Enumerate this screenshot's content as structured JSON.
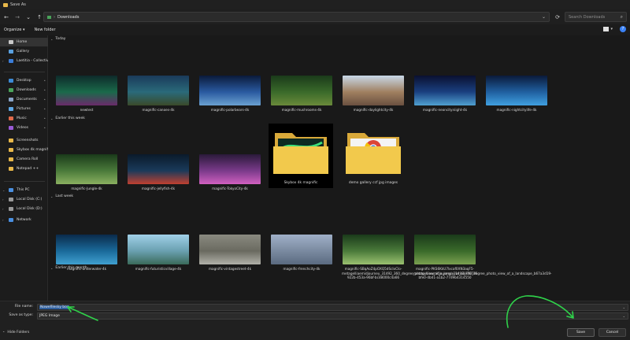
{
  "window": {
    "title": "Save As"
  },
  "nav": {
    "back_icon": "←",
    "forward_icon": "→",
    "recent_icon": "⌄",
    "up_icon": "↑",
    "breadcrumb_sep": "›",
    "address": "Downloads",
    "address_chevron": "⌄",
    "refresh_icon": "⟳",
    "search_placeholder": "Search Downloads",
    "search_icon": "⌕"
  },
  "toolbar": {
    "organize": "Organize ▾",
    "new_folder": "New folder",
    "view_chevron": "▾",
    "help": "?"
  },
  "sidebar": {
    "items": [
      {
        "label": "Home",
        "color": "#c9c9c9",
        "pinned": false,
        "expand": ""
      },
      {
        "label": "Gallery",
        "color": "#5aa0e0",
        "pinned": false,
        "expand": ""
      },
      {
        "label": "Laetitia - Collectivi",
        "color": "#3b7dd8",
        "pinned": false,
        "expand": "›"
      },
      {
        "label": "Desktop",
        "color": "#3c8ad6",
        "pinned": true,
        "expand": ""
      },
      {
        "label": "Downloads",
        "color": "#4aa35a",
        "pinned": true,
        "expand": ""
      },
      {
        "label": "Documents",
        "color": "#8aa4c8",
        "pinned": true,
        "expand": ""
      },
      {
        "label": "Pictures",
        "color": "#5fa8e6",
        "pinned": true,
        "expand": ""
      },
      {
        "label": "Music",
        "color": "#e06a4a",
        "pinned": true,
        "expand": ""
      },
      {
        "label": "Videos",
        "color": "#9a5ad6",
        "pinned": true,
        "expand": ""
      },
      {
        "label": "Screenshots",
        "color": "#e8b84a",
        "pinned": false,
        "expand": ""
      },
      {
        "label": "Skybox 4k magnific",
        "color": "#e8b84a",
        "pinned": false,
        "expand": ""
      },
      {
        "label": "Camera Roll",
        "color": "#e8b84a",
        "pinned": false,
        "expand": ""
      },
      {
        "label": "Notepad ++",
        "color": "#e8b84a",
        "pinned": false,
        "expand": ""
      },
      {
        "label": "This PC",
        "color": "#4a8fe0",
        "pinned": false,
        "expand": "⌄"
      },
      {
        "label": "Local Disk (C:)",
        "color": "#9a9a9a",
        "pinned": false,
        "expand": "›"
      },
      {
        "label": "Local Disk (D:)",
        "color": "#9a9a9a",
        "pinned": false,
        "expand": "›"
      },
      {
        "label": "Network",
        "color": "#4a8fe0",
        "pinned": false,
        "expand": "›"
      }
    ],
    "pin_glyph": "📌"
  },
  "groups": [
    {
      "label": "Today",
      "chevron": "⌄"
    },
    {
      "label": "Earlier this week",
      "chevron": "⌄"
    },
    {
      "label": "Last week",
      "chevron": "⌄"
    },
    {
      "label": "Earlier this month",
      "chevron": "⌄"
    }
  ],
  "files": [
    {
      "label": "newtest",
      "colors": [
        "#0e2a2a",
        "#1a6a4a",
        "#6a2a6a"
      ]
    },
    {
      "label": "magnific-canoes-4k",
      "colors": [
        "#1a3a5a",
        "#2a6a7a",
        "#3a4a2a"
      ]
    },
    {
      "label": "magnific-polarbears-4k",
      "colors": [
        "#0a1a3a",
        "#2a5aa0",
        "#6aa0d0"
      ]
    },
    {
      "label": "magnific-mushrooms-4k",
      "colors": [
        "#1a3a1a",
        "#3a6a2a",
        "#6a8a3a"
      ]
    },
    {
      "label": "magnific-daylightcity-4k",
      "colors": [
        "#c8d8e8",
        "#a08060",
        "#6a5040"
      ]
    },
    {
      "label": "magnific-neoncityniight-4k",
      "colors": [
        "#0a1030",
        "#1a4080",
        "#50a0d0"
      ]
    },
    {
      "label": "magnific-nightcitylife-4k",
      "colors": [
        "#0a1a3a",
        "#2060a0",
        "#40a0e0"
      ]
    },
    {
      "label": "magnific-Jungle-4k",
      "colors": [
        "#1a3a1a",
        "#4a7a3a",
        "#8ab060"
      ]
    },
    {
      "label": "magnific-jellyfish-4k",
      "colors": [
        "#0a1a2a",
        "#1a3a5a",
        "#c04030"
      ]
    },
    {
      "label": "magnific-TokyoCity-4k",
      "colors": [
        "#2a1a3a",
        "#7a3a8a",
        "#d060c0"
      ]
    },
    {
      "label": "magnific-underwater-4k",
      "colors": [
        "#0a2a4a",
        "#1a6a9a",
        "#40a0d0"
      ]
    },
    {
      "label": "magnific-futuristicvillage-4k",
      "colors": [
        "#a0d0e8",
        "#6aa0b0",
        "#3a6a5a"
      ]
    },
    {
      "label": "magnific-vintagestreet-4k",
      "colors": [
        "#8a8a80",
        "#6a6a60",
        "#b0b0a8"
      ]
    },
    {
      "label": "magnific-frenchcity-4k",
      "colors": [
        "#a0b0c8",
        "#7a8aa0",
        "#5a6a80"
      ]
    },
    {
      "label": "magnific-SBqAoZ4pOXQ5dScIxClo-metagelliaemidjourney_31492_360_degree_photo_view_of_a_jungle_wi_a8e76736-922b-453a-96bf-bcd8000c4a66",
      "colors": [
        "#1a3a1a",
        "#4a7a3a",
        "#9ac070"
      ]
    },
    {
      "label": "magnific-PKS6KkU7lxcaf0XN3aqF5-metagelliaemidjourney_31492_360_degree_photo_view_of_a_landscape_b67a3d19-bfe0-4b41-a1b2-77d9b4314550",
      "colors": [
        "#1a3a1a",
        "#3a6a2a",
        "#7aa050"
      ]
    }
  ],
  "folders": [
    {
      "label": "Skybox 4k magnific",
      "emblem": "aurora"
    },
    {
      "label": "demo gallery ccf jpg images",
      "emblem": "chrome"
    }
  ],
  "save": {
    "file_name_label": "File name:",
    "file_name_value": "Nowefilesky box",
    "save_type_label": "Save as type:",
    "save_type_value": "JPEG Image",
    "dropdown_chevron": "⌄",
    "hide_folders_chevron": "⌃",
    "hide_folders": "Hide Folders",
    "save_button": "Save",
    "cancel_button": "Cancel"
  },
  "colors": {
    "annotation_green": "#2fd24a",
    "folder_yellow": "#f2c94c",
    "accent_blue": "#3b82f6"
  }
}
